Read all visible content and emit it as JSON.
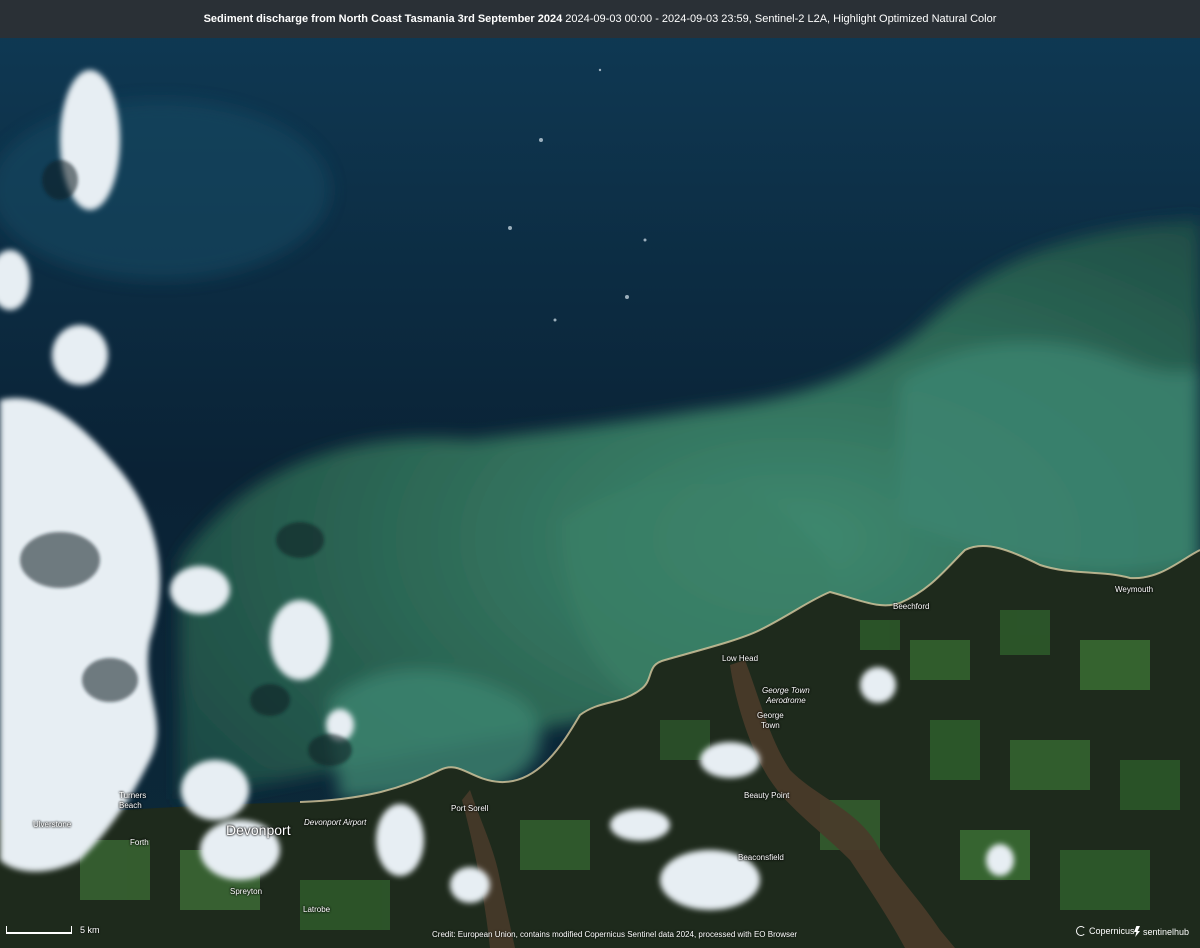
{
  "title": {
    "bold_text": "Sediment discharge from North Coast Tasmania 3rd September 2024",
    "rest_text": " 2024-09-03 00:00 - 2024-09-03 23:59, Sentinel-2 L2A, Highlight Optimized Natural Color"
  },
  "places": {
    "beechford": "Beechford",
    "weymouth": "Weymouth",
    "low_head": "Low Head",
    "george_town_aerodrome": "George Town\nAerodrome",
    "george_town": "George\nTown",
    "port_sorell": "Port Sorell",
    "beauty_point": "Beauty Point",
    "beaconsfield": "Beaconsfield",
    "ulverstone": "Ulverstone",
    "turners_beach": "Turners\nBeach",
    "devonport": "Devonport",
    "devonport_airport": "Devonport Airport",
    "forth": "Forth",
    "spreyton": "Spreyton",
    "latrobe": "Latrobe"
  },
  "scale_label": "5 km",
  "credit": "Credit: European Union, contains modified Copernicus Sentinel data 2024, processed with EO Browser",
  "logos": {
    "copernicus": "Copernicus",
    "sentinelhub": "sentinelhub"
  },
  "colors": {
    "deep_sea": "#0c2638",
    "sediment_sea": "#2f6f5c",
    "land": "#1e2a1c",
    "title_bar": "#2a3036"
  }
}
